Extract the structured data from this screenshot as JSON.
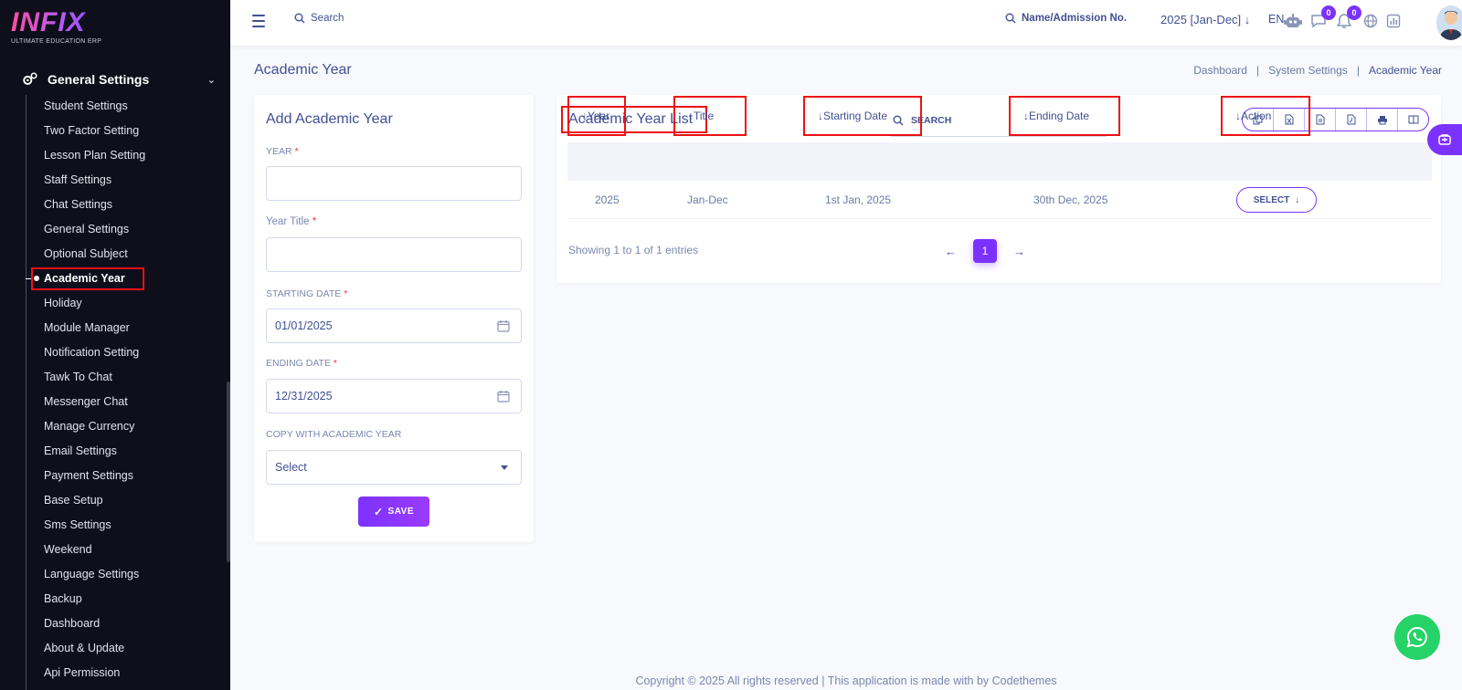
{
  "brand": {
    "logo_text": "INFIX",
    "logo_sub": "ULTIMATE EDUCATION ERP"
  },
  "sidebar": {
    "section_title": "General Settings",
    "items": [
      {
        "label": "Student Settings"
      },
      {
        "label": "Two Factor Setting"
      },
      {
        "label": "Lesson Plan Setting"
      },
      {
        "label": "Staff Settings"
      },
      {
        "label": "Chat Settings"
      },
      {
        "label": "General Settings"
      },
      {
        "label": "Optional Subject"
      },
      {
        "label": "Academic Year",
        "active": true
      },
      {
        "label": "Holiday"
      },
      {
        "label": "Module Manager"
      },
      {
        "label": "Notification Setting"
      },
      {
        "label": "Tawk To Chat"
      },
      {
        "label": "Messenger Chat"
      },
      {
        "label": "Manage Currency"
      },
      {
        "label": "Email Settings"
      },
      {
        "label": "Payment Settings"
      },
      {
        "label": "Base Setup"
      },
      {
        "label": "Sms Settings"
      },
      {
        "label": "Weekend"
      },
      {
        "label": "Language Settings"
      },
      {
        "label": "Backup"
      },
      {
        "label": "Dashboard"
      },
      {
        "label": "About & Update"
      },
      {
        "label": "Api Permission"
      }
    ]
  },
  "topbar": {
    "search_label": "Search",
    "name_search_label": "Name/Admission No.",
    "academic_year": "2025 [Jan-Dec]",
    "language": "EN",
    "chat_badge": "0",
    "notification_badge": "0"
  },
  "page": {
    "title": "Academic Year",
    "breadcrumb": [
      "Dashboard",
      "System Settings",
      "Academic Year"
    ]
  },
  "form": {
    "heading": "Add Academic Year",
    "year_label": "YEAR",
    "year_value": "",
    "year_title_label": "Year Title",
    "year_title_value": "",
    "starting_date_label": "STARTING DATE",
    "starting_date_value": "01/01/2025",
    "ending_date_label": "ENDING DATE",
    "ending_date_value": "12/31/2025",
    "copy_label": "COPY WITH ACADEMIC YEAR",
    "copy_value": "Select",
    "required_mark": "*",
    "save_label": "SAVE"
  },
  "list": {
    "title": "Academic Year List",
    "search_placeholder": "SEARCH",
    "export_icons": [
      "copy-icon",
      "excel-icon",
      "csv-icon",
      "pdf-icon",
      "print-icon",
      "columns-icon"
    ],
    "columns": [
      "Year",
      "Title",
      "Starting Date",
      "Ending Date",
      "Action"
    ],
    "rows": [
      {
        "year": "2025",
        "title": "Jan-Dec",
        "starting_date": "1st Jan, 2025",
        "ending_date": "30th Dec, 2025",
        "action": "SELECT"
      }
    ],
    "showing_text": "Showing 1 to 1 of 1 entries",
    "current_page": "1"
  },
  "footer": {
    "text": "Copyright © 2025 All rights reserved | This application is made with by Codethemes"
  },
  "colors": {
    "accent": "#7c32ff",
    "sidebar_bg": "#0f0f1c",
    "highlight": "#ee1111",
    "text": "#415094"
  }
}
